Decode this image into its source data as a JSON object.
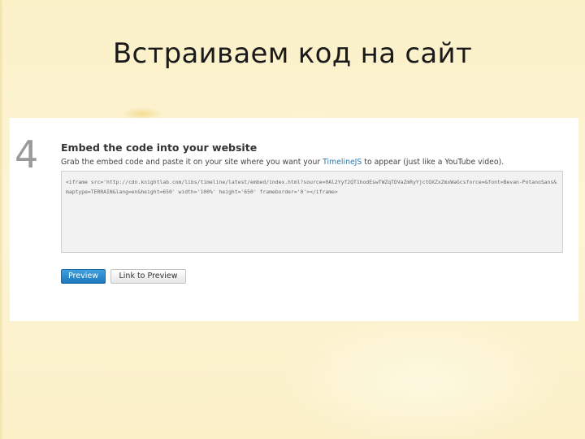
{
  "slide": {
    "title": "Встраиваем код на сайт"
  },
  "step": {
    "number": "4",
    "heading": "Embed the code into your website",
    "instructions_before": "Grab the embed code and paste it on your site where you want your ",
    "instructions_link": "TimelineJS",
    "instructions_after": " to appear (just like a YouTube video).",
    "embed_code": "<iframe src='http://cdn.knightlab.com/libs/timeline/latest/embed/index.html?source=0Al2Yyf2QT1hodEswTWZqTDVaZmRyYjctOXZxZmxWaGcsforce=&font=Bevan-PotanoSans&maptype=TERRAIN&lang=en&height=650' width='100%' height='650' frameborder='0'></iframe>"
  },
  "buttons": {
    "preview_label": "Preview",
    "link_to_preview_label": "Link to Preview"
  },
  "colors": {
    "slide_background": "#fbf3d2",
    "primary_button": "#1d77bd",
    "link": "#2a7ab0"
  }
}
